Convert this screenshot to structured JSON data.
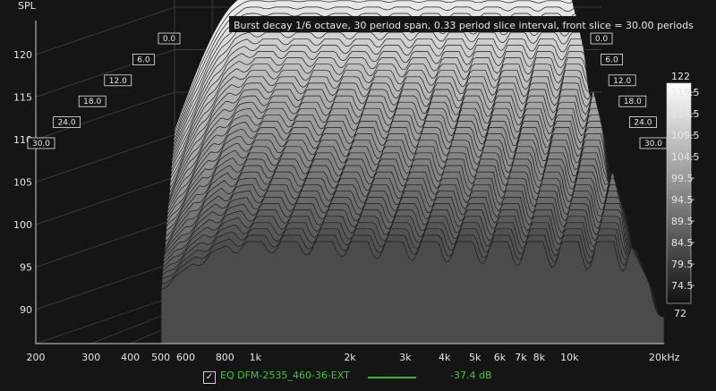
{
  "chart_data": {
    "type": "waterfall-3d",
    "title": "Burst decay 1/6 octave, 30 period span, 0.33 period slice interval,  front slice = 30.00 periods",
    "ylabel": "SPL",
    "x_unit_label": "20kHz",
    "x_ticks": [
      {
        "f": 200,
        "label": "200"
      },
      {
        "f": 300,
        "label": "300"
      },
      {
        "f": 400,
        "label": "400"
      },
      {
        "f": 500,
        "label": "500"
      },
      {
        "f": 600,
        "label": "600"
      },
      {
        "f": 800,
        "label": "800"
      },
      {
        "f": 1000,
        "label": "1k"
      },
      {
        "f": 2000,
        "label": "2k"
      },
      {
        "f": 3000,
        "label": "3k"
      },
      {
        "f": 4000,
        "label": "4k"
      },
      {
        "f": 5000,
        "label": "5k"
      },
      {
        "f": 6000,
        "label": "6k"
      },
      {
        "f": 7000,
        "label": "7k"
      },
      {
        "f": 8000,
        "label": "8k"
      },
      {
        "f": 10000,
        "label": "10k"
      }
    ],
    "xlim": [
      200,
      20000
    ],
    "x_scale": "log",
    "y_ticks": [
      {
        "v": 90,
        "label": "90"
      },
      {
        "v": 95,
        "label": "95"
      },
      {
        "v": 100,
        "label": "100"
      },
      {
        "v": 105,
        "label": "105"
      },
      {
        "v": 110,
        "label": "110"
      },
      {
        "v": 115,
        "label": "115"
      },
      {
        "v": 120,
        "label": "120"
      }
    ],
    "ylim": [
      86,
      124
    ],
    "z_ticks": [
      {
        "v": 0,
        "label": "0.0"
      },
      {
        "v": 6,
        "label": "6.0"
      },
      {
        "v": 12,
        "label": "12.0"
      },
      {
        "v": 18,
        "label": "18.0"
      },
      {
        "v": 24,
        "label": "24.0"
      },
      {
        "v": 30,
        "label": "30.0"
      }
    ],
    "zlim": [
      0,
      30
    ],
    "slice_count": 40,
    "slices": [
      {
        "period": 0.0,
        "peak_spl": 121.5
      },
      {
        "period": 30.0,
        "peak_spl": 98.0
      }
    ],
    "colorbar": {
      "max_label": "122",
      "min_label": "72",
      "labels": [
        "119.5",
        "114.5",
        "109.5",
        "104.5",
        "99.5",
        "94.5",
        "89.5",
        "84.5",
        "79.5",
        "74.5"
      ]
    },
    "legend": {
      "name": "EQ DFM-2535_460-36-EXT",
      "value": "-37.4 dB",
      "checked": true,
      "color": "#2fbf2f"
    }
  }
}
